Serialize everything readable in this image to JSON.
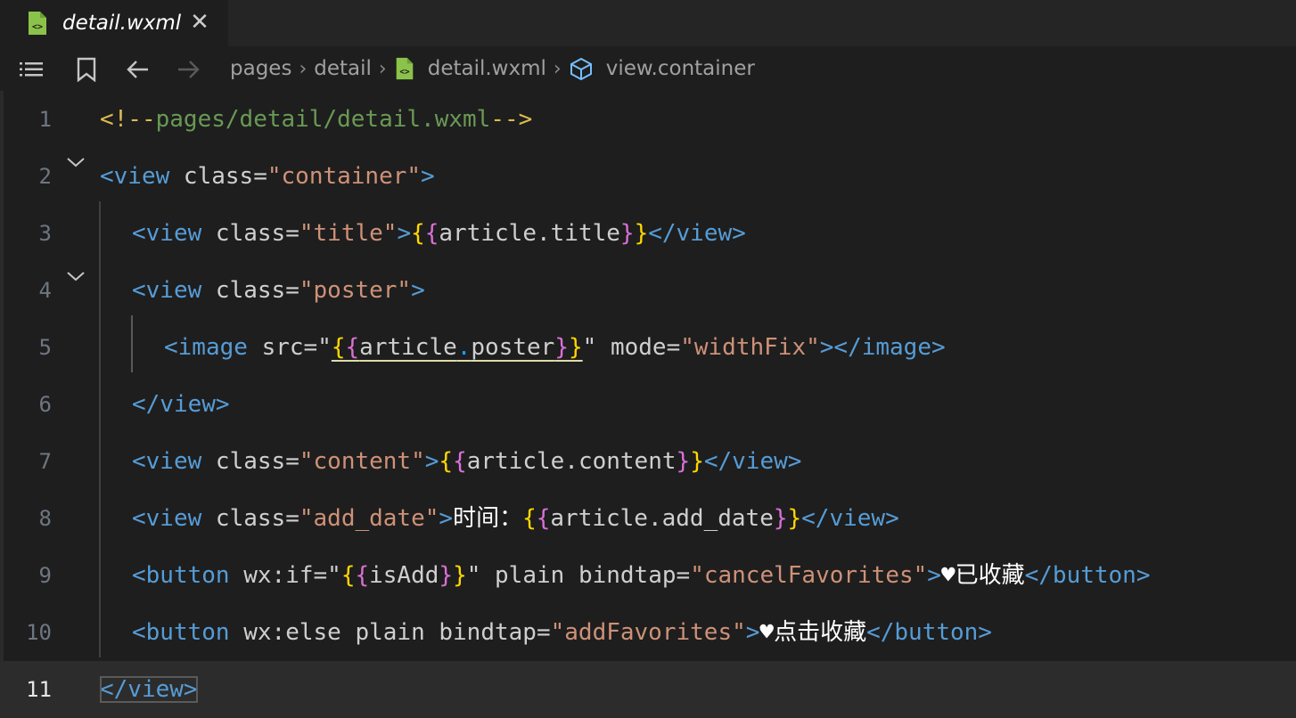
{
  "tab": {
    "label": "detail.wxml",
    "close_glyph": "✕"
  },
  "breadcrumb": [
    "pages",
    "detail",
    "detail.wxml",
    "view.container"
  ],
  "breadcrumb_sep": "›",
  "colors": {
    "tag": "#569cd6",
    "string": "#ce9178",
    "comment": "#6a9955",
    "bracket1": "#ffd700",
    "bracket2": "#da70d6",
    "bracket3": "#179fff"
  },
  "lines": [
    {
      "n": "1",
      "tokens": [
        [
          "cb",
          "<!--"
        ],
        [
          "c",
          "pages/detail/detail.wxml"
        ],
        [
          "cb",
          "-->"
        ]
      ]
    },
    {
      "n": "2",
      "tokens": [
        [
          "tag",
          "<view"
        ],
        [
          "a",
          " class="
        ],
        [
          "s",
          "\"container\""
        ],
        [
          "tag",
          ">"
        ]
      ]
    },
    {
      "n": "3",
      "tokens": [
        [
          "tag",
          "<view"
        ],
        [
          "a",
          " class="
        ],
        [
          "s",
          "\"title\""
        ],
        [
          "tag",
          ">"
        ],
        [
          "b1",
          "{"
        ],
        [
          "b2",
          "{"
        ],
        [
          "e",
          "article.title"
        ],
        [
          "b2",
          "}"
        ],
        [
          "b1",
          "}"
        ],
        [
          "tag",
          "</view>"
        ]
      ]
    },
    {
      "n": "4",
      "tokens": [
        [
          "tag",
          "<view"
        ],
        [
          "a",
          " class="
        ],
        [
          "s",
          "\"poster\""
        ],
        [
          "tag",
          ">"
        ]
      ]
    },
    {
      "n": "5",
      "tokens": [
        [
          "tag",
          "<image"
        ],
        [
          "a",
          " src="
        ],
        [
          "a",
          "\""
        ],
        [
          "b1",
          "{"
        ],
        [
          "b2",
          "{"
        ],
        [
          "e",
          "article"
        ],
        [
          "b3",
          "."
        ],
        [
          "e",
          "poster"
        ],
        [
          "b2",
          "}"
        ],
        [
          "b1",
          "}"
        ],
        [
          "a",
          "\""
        ],
        [
          "a",
          " mode="
        ],
        [
          "s",
          "\"widthFix\""
        ],
        [
          "tag",
          "></image>"
        ]
      ]
    },
    {
      "n": "6",
      "tokens": [
        [
          "tag",
          "</view>"
        ]
      ]
    },
    {
      "n": "7",
      "tokens": [
        [
          "tag",
          "<view"
        ],
        [
          "a",
          " class="
        ],
        [
          "s",
          "\"content\""
        ],
        [
          "tag",
          ">"
        ],
        [
          "b1",
          "{"
        ],
        [
          "b2",
          "{"
        ],
        [
          "e",
          "article.content"
        ],
        [
          "b2",
          "}"
        ],
        [
          "b1",
          "}"
        ],
        [
          "tag",
          "</view>"
        ]
      ]
    },
    {
      "n": "8",
      "tokens": [
        [
          "tag",
          "<view"
        ],
        [
          "a",
          " class="
        ],
        [
          "s",
          "\"add_date\""
        ],
        [
          "tag",
          ">"
        ],
        [
          "t",
          "时间："
        ],
        [
          "b1",
          "{"
        ],
        [
          "b2",
          "{"
        ],
        [
          "e",
          "article.add_date"
        ],
        [
          "b2",
          "}"
        ],
        [
          "b1",
          "}"
        ],
        [
          "tag",
          "</view>"
        ]
      ]
    },
    {
      "n": "9",
      "tokens": [
        [
          "tag",
          "<button"
        ],
        [
          "a",
          " wx:if="
        ],
        [
          "a",
          "\""
        ],
        [
          "b1",
          "{"
        ],
        [
          "b2",
          "{"
        ],
        [
          "e",
          "isAdd"
        ],
        [
          "b2",
          "}"
        ],
        [
          "b1",
          "}"
        ],
        [
          "a",
          "\""
        ],
        [
          "a",
          " plain bindtap="
        ],
        [
          "s",
          "\"cancelFavorites\""
        ],
        [
          "tag",
          ">"
        ],
        [
          "t",
          "♥已收藏"
        ],
        [
          "tag",
          "</button>"
        ]
      ]
    },
    {
      "n": "10",
      "tokens": [
        [
          "tag",
          "<button"
        ],
        [
          "a",
          " wx:else plain bindtap="
        ],
        [
          "s",
          "\"addFavorites\""
        ],
        [
          "tag",
          ">"
        ],
        [
          "t",
          "♥点击收藏"
        ],
        [
          "tag",
          "</button>"
        ]
      ]
    },
    {
      "n": "11",
      "tokens": [
        [
          "tag",
          "</view>"
        ]
      ]
    }
  ]
}
